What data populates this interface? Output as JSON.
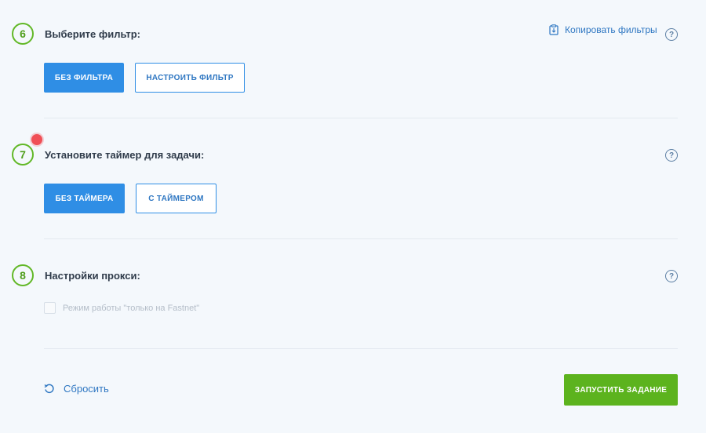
{
  "step6": {
    "number": "6",
    "title": "Выберите фильтр:",
    "copy_filters_label": "Копировать фильтры",
    "help": "?",
    "buttons": {
      "no_filter": "БЕЗ ФИЛЬТРА",
      "configure_filter": "НАСТРОИТЬ ФИЛЬТР"
    }
  },
  "step7": {
    "number": "7",
    "title": "Установите таймер для задачи:",
    "help": "?",
    "buttons": {
      "no_timer": "БЕЗ ТАЙМЕРА",
      "with_timer": "С ТАЙМЕРОМ"
    }
  },
  "step8": {
    "number": "8",
    "title": "Настройки прокси:",
    "help": "?",
    "checkbox_label": "Режим работы \"только на Fastnet\""
  },
  "footer": {
    "reset_label": "Сбросить",
    "start_label": "ЗАПУСТИТЬ ЗАДАНИЕ"
  },
  "colors": {
    "accent_blue": "#2f8ee5",
    "accent_green": "#5cb31e",
    "indicator_red": "#f04f56",
    "background": "#f4f8fc"
  }
}
